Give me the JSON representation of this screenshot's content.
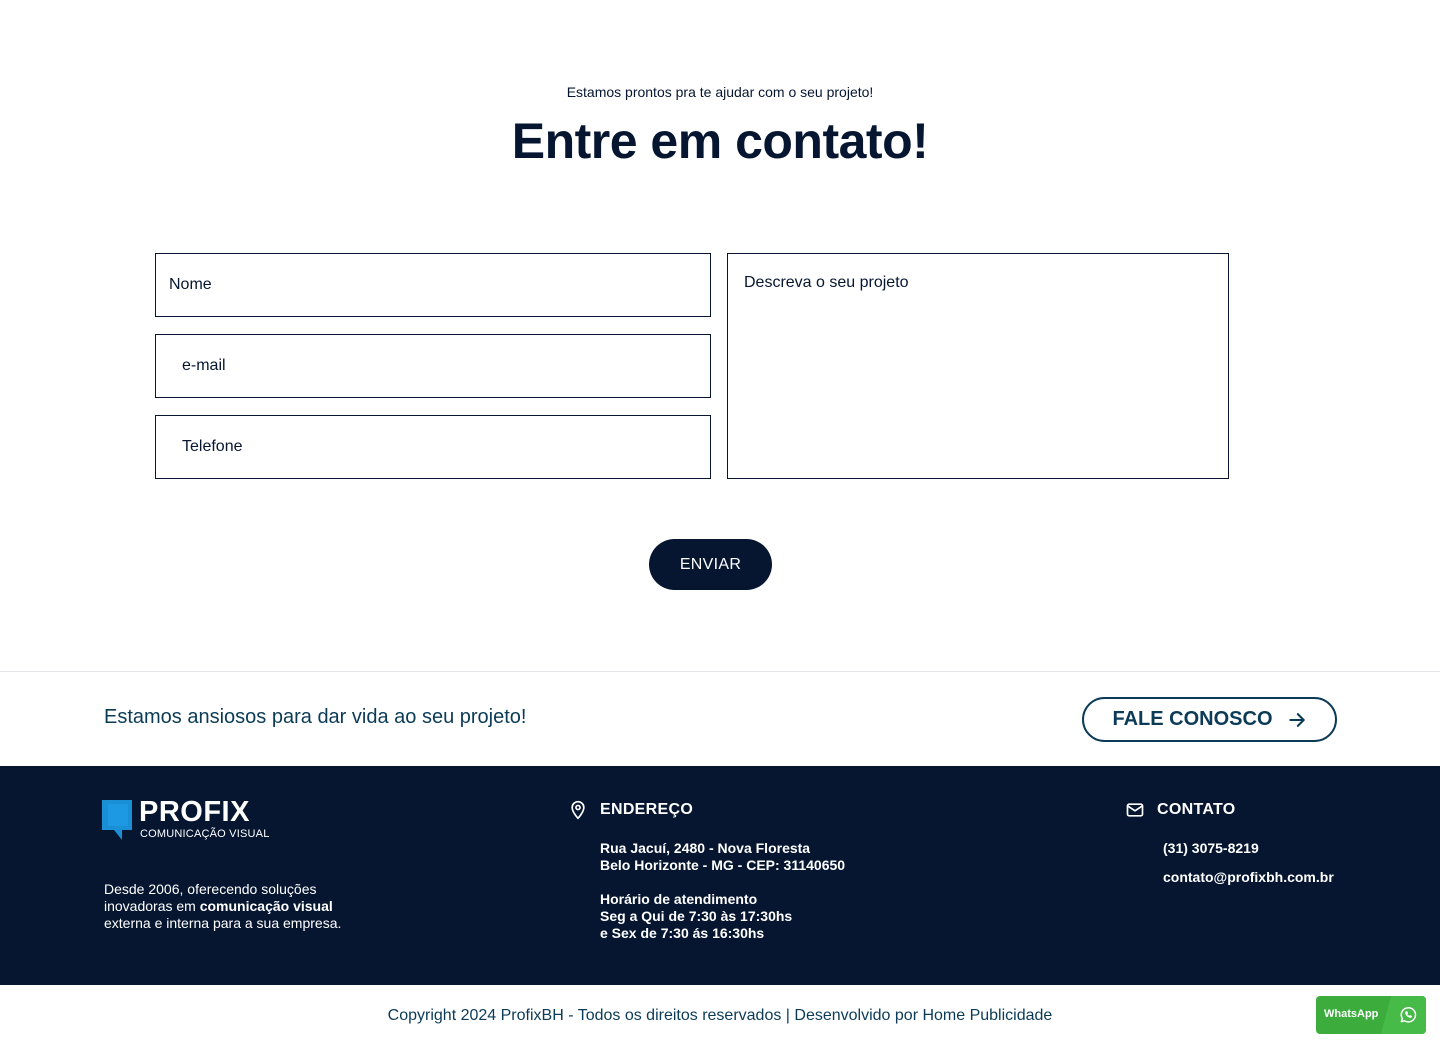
{
  "contact": {
    "kicker": "Estamos prontos pra te ajudar com o seu projeto!",
    "headline": "Entre em contato!",
    "form": {
      "name_placeholder": "Nome",
      "email_placeholder": "e-mail",
      "phone_placeholder": "Telefone",
      "description_placeholder": "Descreva o seu projeto",
      "submit_label": "ENVIAR"
    }
  },
  "cta": {
    "text": "Estamos ansiosos para dar vida ao seu projeto!",
    "button_label": "FALE CONOSCO",
    "button_icon": "arrow-right-icon"
  },
  "footer": {
    "logo": {
      "name": "PROFIX",
      "subtitle": "COMUNICAÇÃO VISUAL"
    },
    "about": {
      "part1": "Desde 2006, oferecendo soluções inovadoras em ",
      "bold": "comunicação visual",
      "part2": " externa e interna para a sua empresa."
    },
    "address": {
      "heading": "ENDEREÇO",
      "icon": "map-pin-icon",
      "line1": "Rua Jacuí, 2480 - Nova Floresta",
      "line2": "Belo Horizonte - MG - CEP: 31140650",
      "hours_title": "Horário de atendimento",
      "hours_line1": "Seg a Qui de 7:30 às 17:30hs",
      "hours_line2": "e Sex de 7:30 ás 16:30hs"
    },
    "contact": {
      "heading": "CONTATO",
      "icon": "mail-icon",
      "phone": "(31) 3075-8219",
      "email": "contato@profixbh.com.br"
    }
  },
  "copyright": "Copyright 2024 ProfixBH - Todos os direitos reservados | Desenvolvido por Home Publicidade",
  "whatsapp": {
    "label": "WhatsApp",
    "icon": "whatsapp-icon"
  },
  "colors": {
    "navy": "#061631",
    "teal_text": "#0b3b57",
    "whatsapp_green": "#3cad3d",
    "logo_blue": "#1a8fd6"
  }
}
